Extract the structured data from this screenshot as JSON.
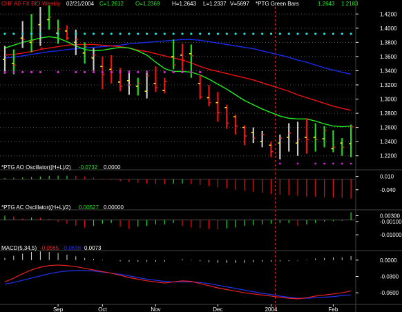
{
  "header": {
    "symbol": "CHF A0-FX BID-Weekly",
    "date": "02/21/2004",
    "close": "C=1.2612",
    "open": "O=1.2369",
    "high": "H=1.2643",
    "low": "L=1.2337",
    "volume": "V=5697",
    "study": "*PTG Green Bars",
    "v1": "1.2643",
    "v2": "1.2183"
  },
  "ao_panel": {
    "name": "*PTG AO Oscillator((H+L)/2)",
    "v1": "-0.0732",
    "v2": "0.0000"
  },
  "ac_panel": {
    "name": "*PTG AC Oscillator((H+L)/2)",
    "v1": "0.00527",
    "v2": "0.00000"
  },
  "macd_panel": {
    "name": "MACD(5,34,5)",
    "v1": "-0.0565",
    "v2": "-0.0638",
    "v3": "0.0073"
  },
  "price_axis": [
    "1.4200",
    "1.4000",
    "1.3800",
    "1.3600",
    "1.3400",
    "1.3200",
    "1.3000",
    "1.2800",
    "1.2600",
    "1.2400",
    "1.2200"
  ],
  "ao_axis": [
    "0.010",
    "-0.040"
  ],
  "ac_axis": [
    "0.00300",
    "-0.00100",
    "-0.01000"
  ],
  "macd_axis": [
    "0.0000",
    "-0.0300",
    "-0.0600"
  ],
  "x_axis": [
    "Sep",
    "Oct",
    "Nov",
    "Dec",
    "2004",
    "Feb"
  ],
  "colors": {
    "up": "#22dd22",
    "down": "#ee1111",
    "neutral": "#c8c8c8",
    "ma_fast": "#22ee22",
    "ma_mid": "#ee1111",
    "ma_slow": "#1a2aee",
    "dots_top": "#22dddd",
    "dots_bottom": "#dd22dd",
    "grid": "#5a5a5a",
    "axis_text": "#ffffff",
    "macd_line": "#ee2222",
    "macd_signal": "#2233ee"
  },
  "chart_data": [
    {
      "type": "ohlc",
      "title": "CHF A0-FX BID-Weekly",
      "ylim": [
        1.21,
        1.43
      ],
      "yticks": [
        1.42,
        1.4,
        1.38,
        1.36,
        1.34,
        1.32,
        1.3,
        1.28,
        1.26,
        1.24,
        1.22
      ],
      "grid": true,
      "bars": [
        {
          "o": 1.356,
          "h": 1.375,
          "l": 1.336,
          "c": 1.362,
          "color": "neutral"
        },
        {
          "o": 1.35,
          "h": 1.37,
          "l": 1.335,
          "c": 1.348,
          "color": "up"
        },
        {
          "o": 1.386,
          "h": 1.41,
          "l": 1.372,
          "c": 1.384,
          "color": "neutral"
        },
        {
          "o": 1.38,
          "h": 1.42,
          "l": 1.366,
          "c": 1.382,
          "color": "up"
        },
        {
          "o": 1.405,
          "h": 1.43,
          "l": 1.375,
          "c": 1.372,
          "color": "neutral"
        },
        {
          "o": 1.412,
          "h": 1.432,
          "l": 1.398,
          "c": 1.416,
          "color": "up"
        },
        {
          "o": 1.393,
          "h": 1.412,
          "l": 1.378,
          "c": 1.399,
          "color": "up"
        },
        {
          "o": 1.396,
          "h": 1.404,
          "l": 1.383,
          "c": 1.386,
          "color": "down"
        },
        {
          "o": 1.38,
          "h": 1.398,
          "l": 1.362,
          "c": 1.384,
          "color": "neutral"
        },
        {
          "o": 1.365,
          "h": 1.38,
          "l": 1.35,
          "c": 1.374,
          "color": "up"
        },
        {
          "o": 1.358,
          "h": 1.372,
          "l": 1.34,
          "c": 1.362,
          "color": "neutral"
        },
        {
          "o": 1.346,
          "h": 1.36,
          "l": 1.314,
          "c": 1.335,
          "color": "down"
        },
        {
          "o": 1.342,
          "h": 1.362,
          "l": 1.322,
          "c": 1.338,
          "color": "down"
        },
        {
          "o": 1.324,
          "h": 1.344,
          "l": 1.311,
          "c": 1.318,
          "color": "down"
        },
        {
          "o": 1.326,
          "h": 1.34,
          "l": 1.306,
          "c": 1.32,
          "color": "neutral"
        },
        {
          "o": 1.318,
          "h": 1.33,
          "l": 1.305,
          "c": 1.322,
          "color": "up"
        },
        {
          "o": 1.311,
          "h": 1.34,
          "l": 1.301,
          "c": 1.333,
          "color": "neutral"
        },
        {
          "o": 1.322,
          "h": 1.346,
          "l": 1.31,
          "c": 1.316,
          "color": "down"
        },
        {
          "o": 1.312,
          "h": 1.33,
          "l": 1.308,
          "c": 1.325,
          "color": "down"
        },
        {
          "o": 1.36,
          "h": 1.384,
          "l": 1.342,
          "c": 1.348,
          "color": "up"
        },
        {
          "o": 1.362,
          "h": 1.378,
          "l": 1.34,
          "c": 1.355,
          "color": "down"
        },
        {
          "o": 1.364,
          "h": 1.377,
          "l": 1.33,
          "c": 1.361,
          "color": "up"
        },
        {
          "o": 1.322,
          "h": 1.334,
          "l": 1.3,
          "c": 1.303,
          "color": "down"
        },
        {
          "o": 1.302,
          "h": 1.32,
          "l": 1.29,
          "c": 1.295,
          "color": "down"
        },
        {
          "o": 1.295,
          "h": 1.31,
          "l": 1.268,
          "c": 1.281,
          "color": "down"
        },
        {
          "o": 1.288,
          "h": 1.292,
          "l": 1.258,
          "c": 1.266,
          "color": "down"
        },
        {
          "o": 1.275,
          "h": 1.278,
          "l": 1.25,
          "c": 1.262,
          "color": "down"
        },
        {
          "o": 1.26,
          "h": 1.263,
          "l": 1.235,
          "c": 1.248,
          "color": "down"
        },
        {
          "o": 1.253,
          "h": 1.26,
          "l": 1.238,
          "c": 1.245,
          "color": "neutral"
        },
        {
          "o": 1.24,
          "h": 1.255,
          "l": 1.232,
          "c": 1.25,
          "color": "neutral"
        },
        {
          "o": 1.235,
          "h": 1.24,
          "l": 1.218,
          "c": 1.226,
          "color": "down"
        },
        {
          "o": 1.238,
          "h": 1.25,
          "l": 1.215,
          "c": 1.245,
          "color": "neutral"
        },
        {
          "o": 1.246,
          "h": 1.266,
          "l": 1.226,
          "c": 1.252,
          "color": "neutral"
        },
        {
          "o": 1.238,
          "h": 1.268,
          "l": 1.22,
          "c": 1.243,
          "color": "neutral"
        },
        {
          "o": 1.246,
          "h": 1.273,
          "l": 1.223,
          "c": 1.243,
          "color": "down"
        },
        {
          "o": 1.246,
          "h": 1.266,
          "l": 1.226,
          "c": 1.243,
          "color": "up"
        },
        {
          "o": 1.244,
          "h": 1.262,
          "l": 1.232,
          "c": 1.256,
          "color": "up"
        },
        {
          "o": 1.23,
          "h": 1.256,
          "l": 1.225,
          "c": 1.232,
          "color": "up"
        },
        {
          "o": 1.238,
          "h": 1.245,
          "l": 1.22,
          "c": 1.232,
          "color": "up"
        },
        {
          "o": 1.237,
          "h": 1.264,
          "l": 1.218,
          "c": 1.261,
          "color": "up"
        }
      ],
      "ma_fast": [
        1.372,
        1.376,
        1.38,
        1.383,
        1.386,
        1.388,
        1.386,
        1.381,
        1.375,
        1.37,
        1.368,
        1.369,
        1.371,
        1.373,
        1.372,
        1.368,
        1.362,
        1.352,
        1.343,
        1.339,
        1.339,
        1.338,
        1.334,
        1.328,
        1.321,
        1.314,
        1.306,
        1.298,
        1.292,
        1.286,
        1.281,
        1.276,
        1.273,
        1.272,
        1.272,
        1.269,
        1.265,
        1.262,
        1.261,
        1.262
      ],
      "ma_mid": [
        1.362,
        1.363,
        1.365,
        1.367,
        1.37,
        1.372,
        1.374,
        1.376,
        1.377,
        1.377,
        1.377,
        1.376,
        1.375,
        1.374,
        1.372,
        1.369,
        1.367,
        1.364,
        1.361,
        1.358,
        1.355,
        1.351,
        1.346,
        1.342,
        1.339,
        1.336,
        1.333,
        1.33,
        1.327,
        1.323,
        1.319,
        1.315,
        1.311,
        1.306,
        1.302,
        1.298,
        1.294,
        1.29,
        1.287,
        1.284
      ],
      "ma_slow": [
        1.358,
        1.359,
        1.361,
        1.363,
        1.365,
        1.367,
        1.368,
        1.37,
        1.371,
        1.372,
        1.373,
        1.374,
        1.375,
        1.376,
        1.378,
        1.379,
        1.38,
        1.381,
        1.382,
        1.383,
        1.384,
        1.384,
        1.383,
        1.381,
        1.379,
        1.377,
        1.375,
        1.373,
        1.371,
        1.368,
        1.365,
        1.362,
        1.359,
        1.355,
        1.352,
        1.348,
        1.344,
        1.341,
        1.338,
        1.335
      ],
      "dots_top_y": 1.392,
      "dots_top_idx": [
        0,
        1,
        2,
        3,
        4,
        6,
        8,
        9,
        10,
        11,
        12,
        13,
        14,
        15,
        16,
        17,
        18,
        19,
        20,
        21,
        22,
        23,
        24,
        25,
        26,
        27,
        28,
        29,
        30,
        31,
        32,
        33,
        34,
        35,
        36,
        37,
        38,
        39
      ],
      "dots_bottom_y": 1.338,
      "dots_bottom_idx": [
        0,
        1,
        2,
        3,
        4,
        6,
        8,
        9,
        10,
        11,
        12,
        13,
        14,
        15,
        16,
        18,
        19,
        20,
        21,
        22
      ],
      "dots_bottom2_y": 1.209,
      "dots_bottom2_idx": [
        31,
        33,
        35,
        36,
        37,
        38,
        39
      ]
    },
    {
      "type": "bar",
      "title": "*PTG AO Oscillator((H+L)/2)",
      "ylim": [
        -0.09,
        0.03
      ],
      "yticks": [
        0.01,
        -0.04
      ],
      "values": [
        0.004,
        0.005,
        0.006,
        0.008,
        0.01,
        0.012,
        0.013,
        0.013,
        0.012,
        0.01,
        0.006,
        0.002,
        -0.003,
        -0.008,
        -0.012,
        -0.014,
        -0.016,
        -0.018,
        -0.019,
        -0.018,
        -0.017,
        -0.019,
        -0.022,
        -0.026,
        -0.031,
        -0.035,
        -0.04,
        -0.044,
        -0.048,
        -0.052,
        -0.056,
        -0.059,
        -0.061,
        -0.063,
        -0.066,
        -0.067,
        -0.068,
        -0.07,
        -0.071,
        -0.0732
      ]
    },
    {
      "type": "bar",
      "title": "*PTG AC Oscillator((H+L)/2)",
      "ylim": [
        -0.016,
        0.006
      ],
      "yticks": [
        0.003,
        -0.001,
        -0.01
      ],
      "values": [
        0.003,
        0.0025,
        0.001,
        0.0018,
        0.0016,
        0.0008,
        -0.0012,
        -0.0025,
        -0.0038,
        -0.005,
        -0.004,
        -0.0025,
        -0.002,
        -0.0045,
        -0.006,
        -0.0045,
        -0.004,
        -0.003,
        -0.003,
        -0.002,
        -0.004,
        -0.005,
        -0.0055,
        -0.006,
        -0.0065,
        -0.0055,
        -0.005,
        -0.004,
        -0.0035,
        -0.003,
        -0.0025,
        -0.002,
        -0.002,
        -0.004,
        -0.003,
        -0.002,
        -0.001,
        -0.0008,
        -0.0005,
        0.00527
      ]
    },
    {
      "type": "line",
      "title": "MACD(5,34,5)",
      "ylim": [
        -0.08,
        0.015
      ],
      "yticks": [
        0.0,
        -0.03,
        -0.06
      ],
      "macd": [
        -0.04,
        -0.033,
        -0.025,
        -0.018,
        -0.013,
        -0.01,
        -0.009,
        -0.01,
        -0.012,
        -0.015,
        -0.018,
        -0.021,
        -0.024,
        -0.028,
        -0.032,
        -0.035,
        -0.038,
        -0.04,
        -0.042,
        -0.04,
        -0.038,
        -0.039,
        -0.043,
        -0.047,
        -0.051,
        -0.054,
        -0.057,
        -0.06,
        -0.062,
        -0.064,
        -0.066,
        -0.068,
        -0.07,
        -0.071,
        -0.069,
        -0.066,
        -0.064,
        -0.062,
        -0.06,
        -0.0565
      ],
      "signal": [
        -0.044,
        -0.041,
        -0.037,
        -0.033,
        -0.029,
        -0.025,
        -0.022,
        -0.02,
        -0.019,
        -0.019,
        -0.02,
        -0.022,
        -0.024,
        -0.026,
        -0.029,
        -0.032,
        -0.035,
        -0.037,
        -0.039,
        -0.04,
        -0.04,
        -0.04,
        -0.041,
        -0.043,
        -0.046,
        -0.049,
        -0.052,
        -0.055,
        -0.058,
        -0.061,
        -0.063,
        -0.066,
        -0.068,
        -0.07,
        -0.07,
        -0.069,
        -0.068,
        -0.067,
        -0.065,
        -0.0638
      ],
      "hist": [
        0.004,
        0.008,
        0.012,
        0.015,
        0.016,
        0.015,
        0.013,
        0.01,
        0.007,
        0.004,
        0.002,
        0.001,
        0.0,
        -0.002,
        -0.003,
        -0.003,
        -0.003,
        -0.003,
        -0.003,
        0.0,
        0.002,
        0.001,
        -0.002,
        -0.004,
        -0.005,
        -0.005,
        -0.005,
        -0.005,
        -0.004,
        -0.003,
        -0.003,
        -0.002,
        -0.002,
        -0.001,
        0.001,
        0.003,
        0.004,
        0.005,
        0.005,
        0.0073
      ]
    }
  ]
}
